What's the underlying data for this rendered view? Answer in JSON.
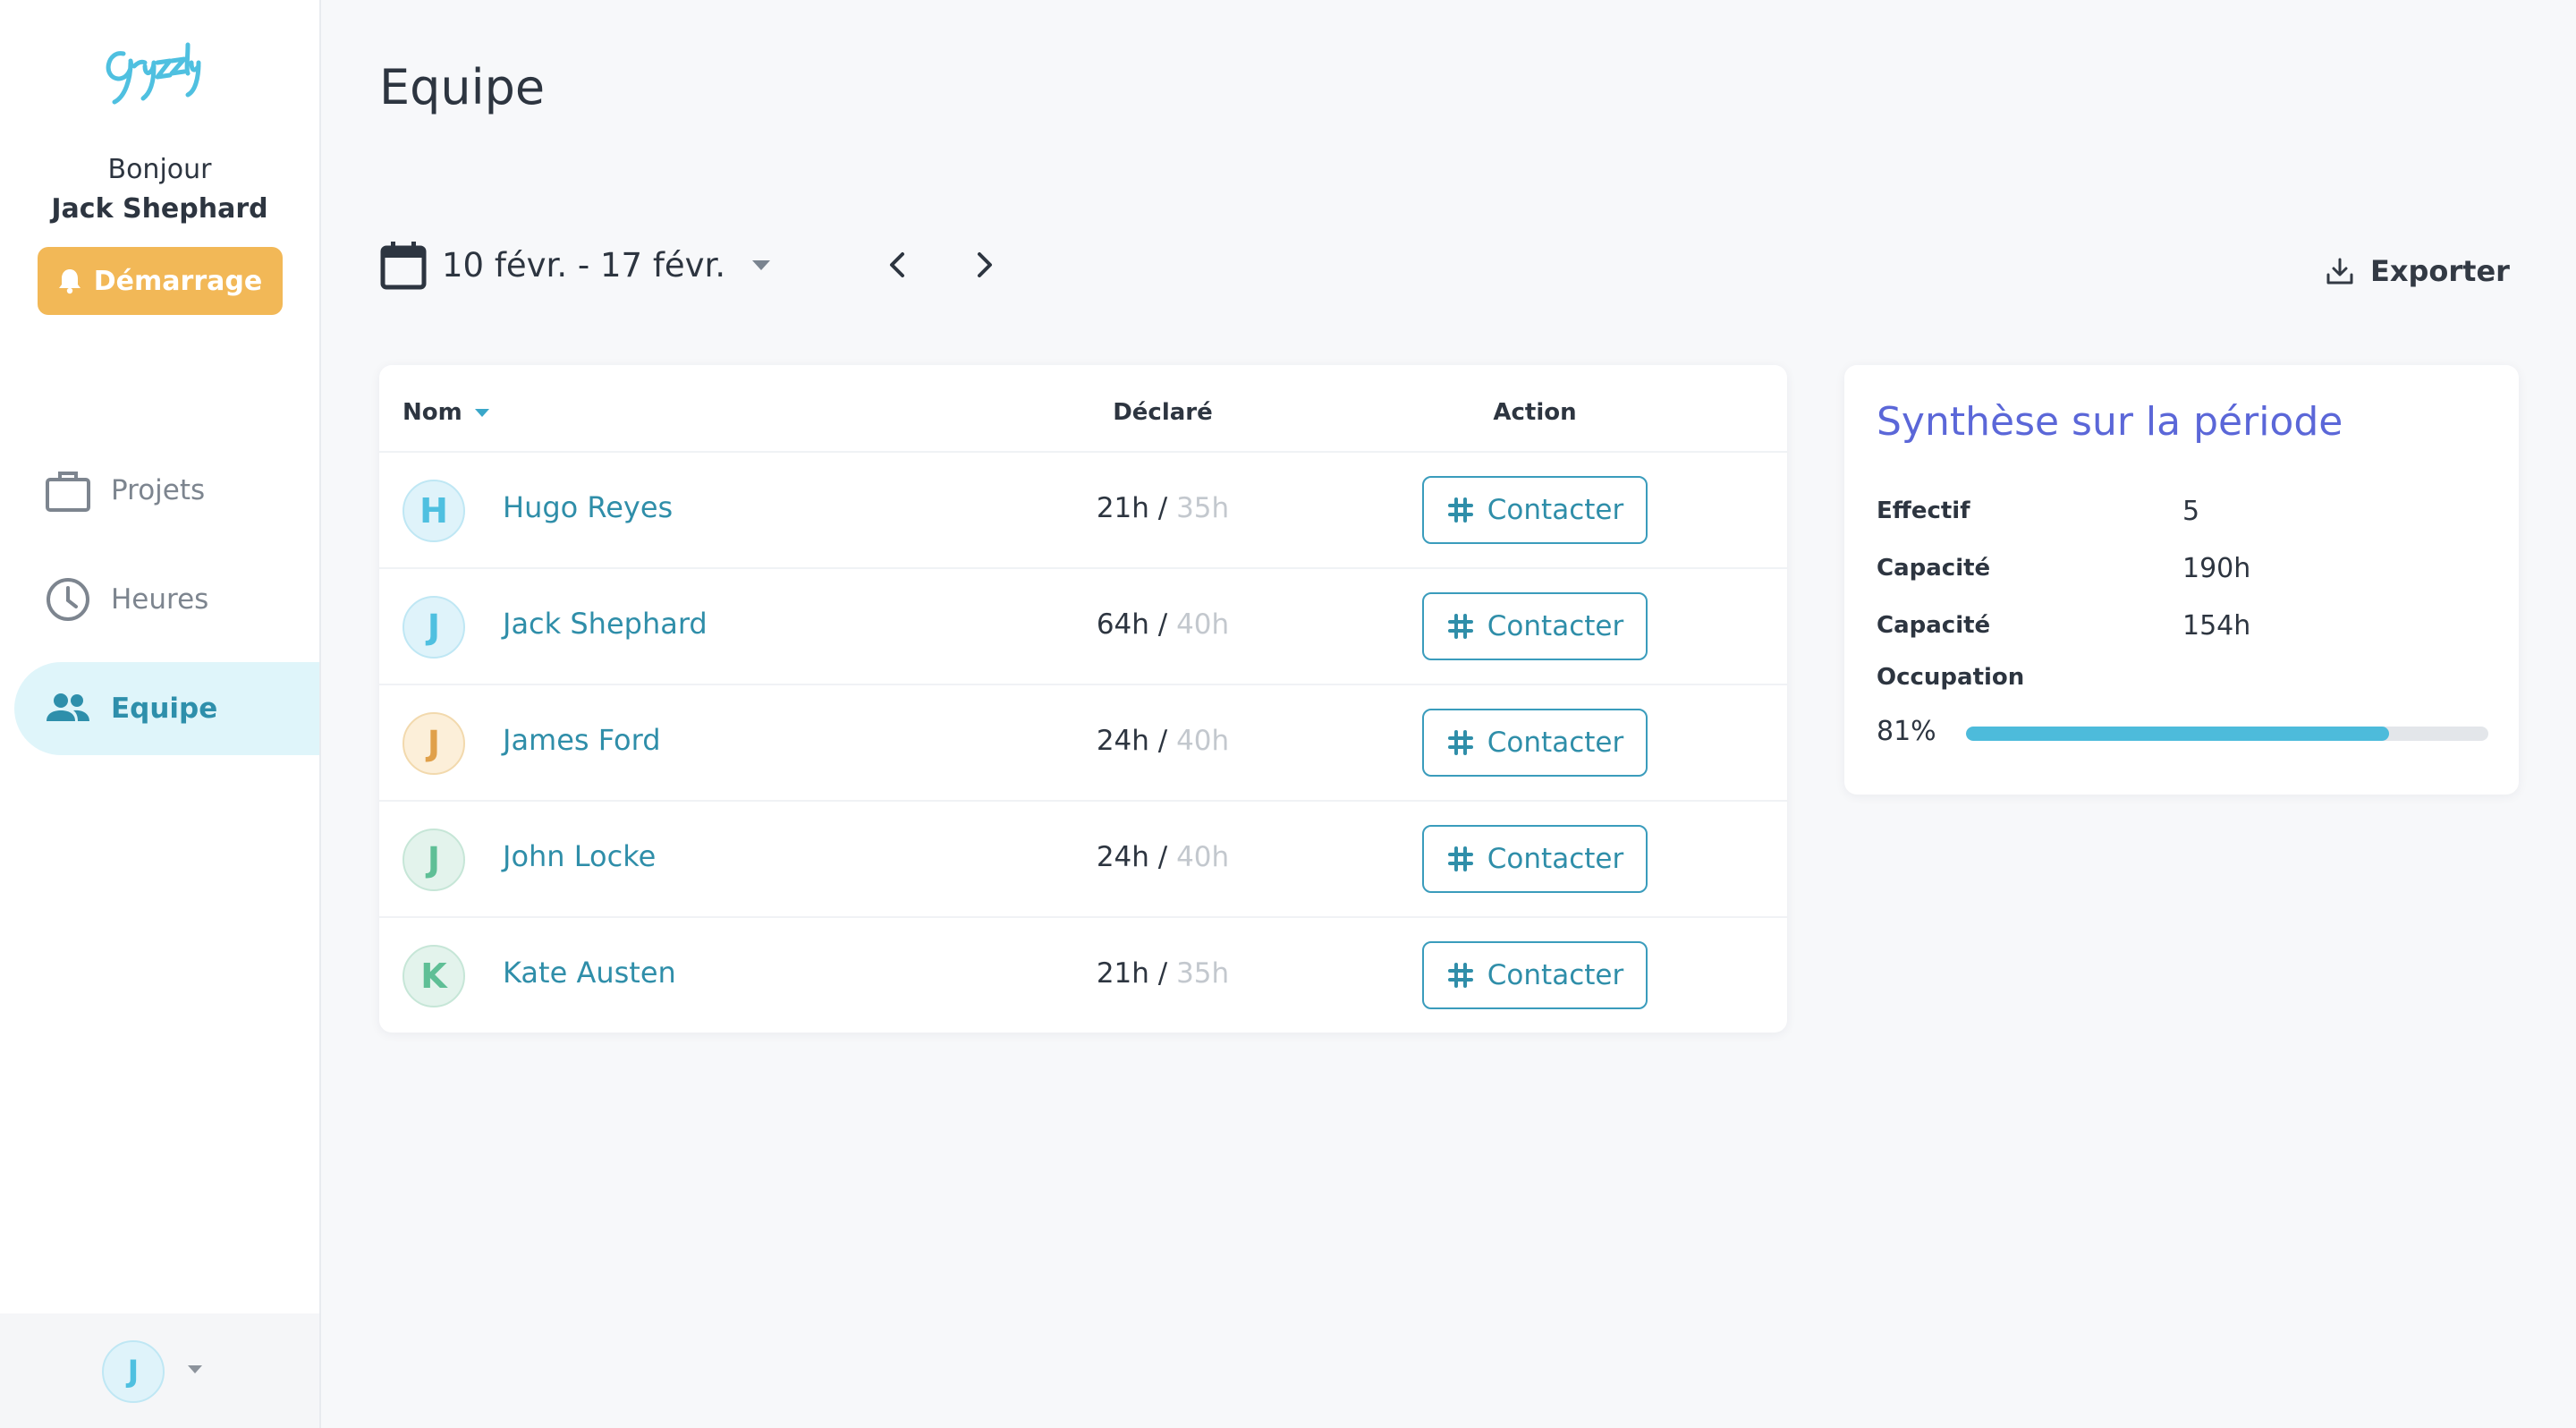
{
  "brand": {
    "logo_text": "Gryzzly",
    "color": "#4fc0e0"
  },
  "sidebar": {
    "greeting": "Bonjour",
    "user_name": "Jack Shephard",
    "start_button": "Démarrage",
    "nav": [
      {
        "label": "Projets",
        "icon": "briefcase-icon",
        "active": false
      },
      {
        "label": "Heures",
        "icon": "clock-icon",
        "active": false
      },
      {
        "label": "Equipe",
        "icon": "team-icon",
        "active": true
      }
    ],
    "account_initial": "J"
  },
  "header": {
    "title": "Equipe",
    "date_range": "10 févr. - 17 févr.",
    "export_label": "Exporter"
  },
  "table": {
    "columns": {
      "name": "Nom",
      "declared": "Déclaré",
      "action": "Action"
    },
    "rows": [
      {
        "initial": "H",
        "name": "Hugo Reyes",
        "declared": "21h /",
        "capacity": "35h",
        "action": "Contacter",
        "avatar_bg": "#dff3fa",
        "avatar_fg": "#4fc0e0",
        "avatar_border": "#bfe7f4"
      },
      {
        "initial": "J",
        "name": "Jack Shephard",
        "declared": "64h /",
        "capacity": "40h",
        "action": "Contacter",
        "avatar_bg": "#dff3fa",
        "avatar_fg": "#4fc0e0",
        "avatar_border": "#bfe7f4"
      },
      {
        "initial": "J",
        "name": "James Ford",
        "declared": "24h /",
        "capacity": "40h",
        "action": "Contacter",
        "avatar_bg": "#fcefd9",
        "avatar_fg": "#e0a04a",
        "avatar_border": "#f2d9ad"
      },
      {
        "initial": "J",
        "name": "John Locke",
        "declared": "24h /",
        "capacity": "40h",
        "action": "Contacter",
        "avatar_bg": "#e3f3ec",
        "avatar_fg": "#5fbf96",
        "avatar_border": "#c6e6d7"
      },
      {
        "initial": "K",
        "name": "Kate Austen",
        "declared": "21h /",
        "capacity": "35h",
        "action": "Contacter",
        "avatar_bg": "#e3f3ec",
        "avatar_fg": "#5fbf96",
        "avatar_border": "#c6e6d7"
      }
    ]
  },
  "summary": {
    "title": "Synthèse sur la période",
    "items": [
      {
        "label": "Effectif",
        "value": "5"
      },
      {
        "label": "Capacité",
        "value": "190h"
      },
      {
        "label": "Capacité",
        "value": "154h"
      }
    ],
    "occupation_label": "Occupation",
    "occupation_value": "81%",
    "occupation_fraction": 0.81
  }
}
